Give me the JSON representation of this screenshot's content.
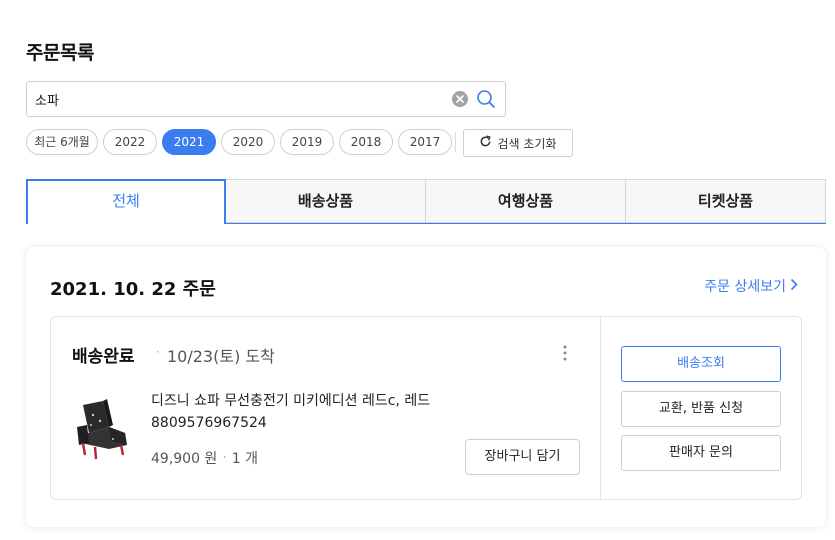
{
  "page_title": "주문목록",
  "search": {
    "value": "소파",
    "placeholder": ""
  },
  "year_filters": [
    {
      "label": "최근 6개월",
      "active": false
    },
    {
      "label": "2022",
      "active": false
    },
    {
      "label": "2021",
      "active": true
    },
    {
      "label": "2020",
      "active": false
    },
    {
      "label": "2019",
      "active": false
    },
    {
      "label": "2018",
      "active": false
    },
    {
      "label": "2017",
      "active": false
    }
  ],
  "reset_label": "검색 초기화",
  "tabs": [
    {
      "label": "전체",
      "active": true
    },
    {
      "label": "배송상품",
      "active": false
    },
    {
      "label": "여행상품",
      "active": false
    },
    {
      "label": "티켓상품",
      "active": false
    }
  ],
  "order": {
    "date": "2021. 10. 22 주문",
    "detail_link": "주문 상세보기",
    "status": "배송완료",
    "dot": "·",
    "arrival": "10/23(토) 도착",
    "product_name": "디즈니 쇼파 무선충전기 미키에디션 레드c, 레드",
    "product_code": "8809576967524",
    "price": "49,900 원",
    "price_sep": "·",
    "quantity": "1 개",
    "cart_button": "장바구니 담기",
    "side_buttons": {
      "track": "배송조회",
      "exchange": "교환, 반품 신청",
      "seller": "판매자 문의"
    }
  },
  "colors": {
    "accent": "#3b7cf0",
    "border": "#cfcfcf"
  }
}
